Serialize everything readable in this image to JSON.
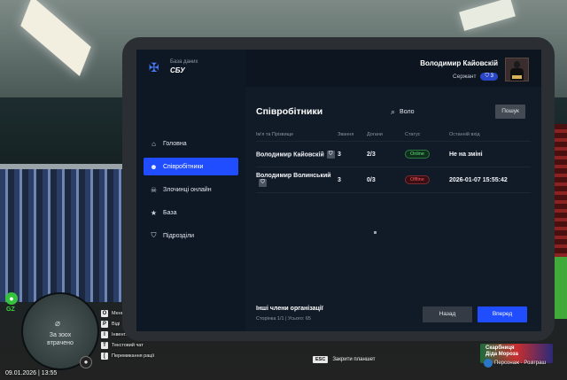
{
  "app": {
    "logo_line1": "База даних",
    "logo_line2": "СБУ"
  },
  "user": {
    "name": "Володимир Кайовскій",
    "rank": "Сержант",
    "level": "3"
  },
  "nav": [
    {
      "label": "Головна",
      "icon": "home-icon"
    },
    {
      "label": "Співробітники",
      "icon": "users-icon",
      "active": true
    },
    {
      "label": "Злочинці онлайн",
      "icon": "criminal-icon"
    },
    {
      "label": "База",
      "icon": "star-icon"
    },
    {
      "label": "Підрозділи",
      "icon": "shield-icon"
    }
  ],
  "main": {
    "title": "Співробітники",
    "search_value": "Воло",
    "search_button": "Пошук",
    "columns": [
      "Ім'я та Прізвище",
      "Звання",
      "Догани",
      "Статус",
      "Останній вхід"
    ],
    "rows": [
      {
        "name": "Володимир Кайовскій",
        "rank": "3",
        "reprimands": "2/3",
        "status": "Online",
        "last_login": "Не на зміні"
      },
      {
        "name": "Володимир Волинський",
        "rank": "3",
        "reprimands": "0/3",
        "status": "Offline",
        "last_login": "2026-01-07 15:55:42"
      }
    ],
    "footer_title": "Інші члени організації",
    "footer_sub": "Сторінка 1/1 | Усього: 65",
    "back_button": "Назад",
    "next_button": "Вперед"
  },
  "hud": {
    "minimap_text_1": "За зоох",
    "minimap_text_2": "втрачено",
    "gz": "GZ",
    "time": "09.01.2026 | 13:55",
    "hotkeys": [
      {
        "key": "O",
        "text": "Меню"
      },
      {
        "key": "P",
        "text": "Віді"
      },
      {
        "key": "I",
        "text": "Інвент."
      },
      {
        "key": "T",
        "text": "Текстовий чат"
      },
      {
        "key": "[",
        "text": "Перемикання рації"
      }
    ],
    "esc_key": "ESC",
    "esc_text": "Закрити планшет",
    "event_title_1": "Скарбниця",
    "event_title_2": "Діда Мороза",
    "event_sub": "Персонаж · Розіграш"
  },
  "colors": {
    "accent": "#1f4dff",
    "online": "#5fe07a",
    "offline": "#ff5561"
  }
}
